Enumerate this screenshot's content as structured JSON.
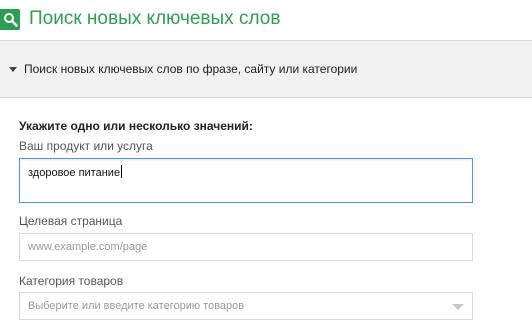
{
  "header": {
    "title": "Поиск новых ключевых слов",
    "icon": "search-icon",
    "accent_color": "#2f9e55"
  },
  "section": {
    "title": "Поиск новых ключевых слов по фразе, сайту или категории",
    "expanded": true
  },
  "form": {
    "instruction": "Укажите одно или несколько значений:",
    "product": {
      "label": "Ваш продукт или услуга",
      "value": "здоровое питание"
    },
    "landing_page": {
      "label": "Целевая страница",
      "placeholder": "www.example.com/page"
    },
    "category": {
      "label": "Категория товаров",
      "placeholder": "Выберите или введите категорию товаров"
    }
  }
}
